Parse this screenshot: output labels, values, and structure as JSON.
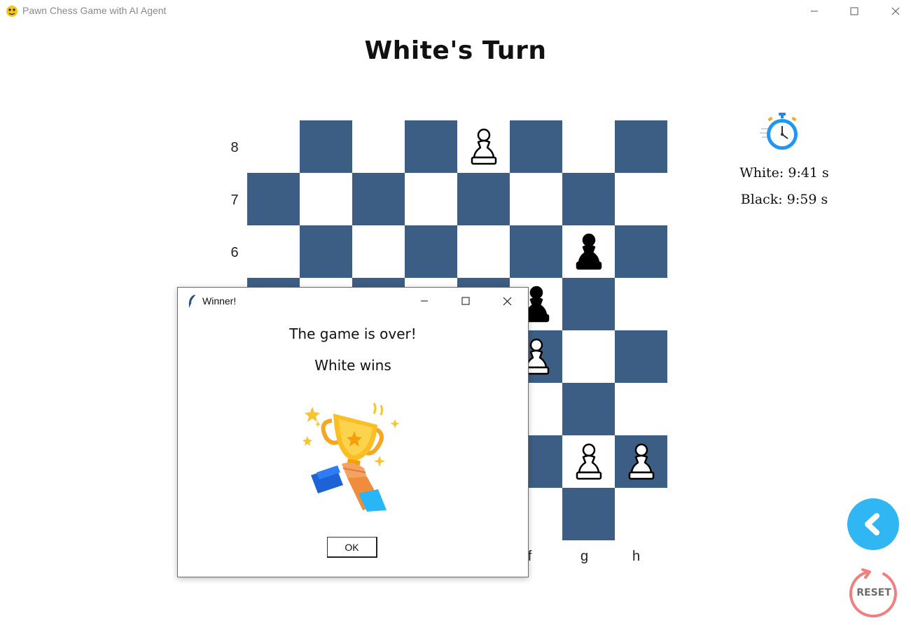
{
  "window": {
    "title": "Pawn Chess Game with AI Agent",
    "icon": "python-snake-icon"
  },
  "game": {
    "turn_title": "White's Turn",
    "board_colors": {
      "dark": "#3c5e85",
      "light": "#ffffff"
    },
    "ranks": [
      "8",
      "7",
      "6"
    ],
    "files": [
      "f",
      "g",
      "h"
    ],
    "pieces": [
      {
        "square": "e8",
        "color": "white",
        "type": "pawn"
      },
      {
        "square": "g6",
        "color": "black",
        "type": "pawn"
      },
      {
        "square": "f5",
        "color": "black",
        "type": "pawn"
      },
      {
        "square": "f4",
        "color": "white",
        "type": "pawn"
      },
      {
        "square": "g2",
        "color": "white",
        "type": "pawn"
      },
      {
        "square": "h2",
        "color": "white",
        "type": "pawn"
      }
    ]
  },
  "timer": {
    "icon": "stopwatch-icon",
    "white": "White: 9:41 s",
    "black": "Black: 9:59 s"
  },
  "controls": {
    "back_icon": "back-chevron-icon",
    "reset_label": "RESET"
  },
  "dialog": {
    "title": "Winner!",
    "message": "The game is over!",
    "winner": "White wins",
    "image": "trophy-icon",
    "ok_label": "OK"
  }
}
